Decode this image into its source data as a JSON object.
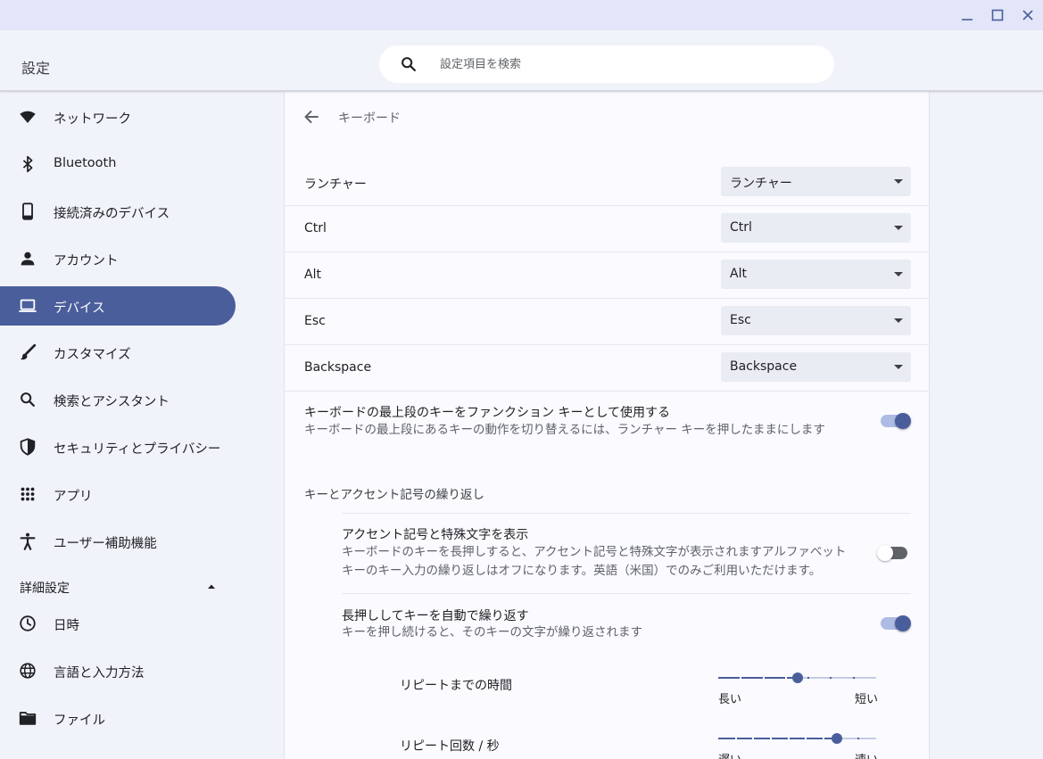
{
  "window": {
    "title": "設定",
    "controls": [
      "minimize-icon",
      "maximize-icon",
      "close-icon"
    ]
  },
  "search": {
    "placeholder": "設定項目を検索"
  },
  "sidebar": {
    "items": [
      {
        "label": "ネットワーク",
        "icon": "wifi-icon"
      },
      {
        "label": "Bluetooth",
        "icon": "bluetooth-icon"
      },
      {
        "label": "接続済みのデバイス",
        "icon": "phone-icon"
      },
      {
        "label": "アカウント",
        "icon": "person-icon"
      },
      {
        "label": "デバイス",
        "icon": "laptop-icon",
        "active": true
      },
      {
        "label": "カスタマイズ",
        "icon": "brush-icon"
      },
      {
        "label": "検索とアシスタント",
        "icon": "search-icon"
      },
      {
        "label": "セキュリティとプライバシー",
        "icon": "shield-icon"
      },
      {
        "label": "アプリ",
        "icon": "apps-grid-icon"
      },
      {
        "label": "ユーザー補助機能",
        "icon": "accessibility-icon"
      }
    ],
    "advanced": {
      "label": "詳細設定",
      "expanded": true
    },
    "advanced_items": [
      {
        "label": "日時",
        "icon": "clock-icon"
      },
      {
        "label": "言語と入力方法",
        "icon": "globe-icon"
      },
      {
        "label": "ファイル",
        "icon": "folder-icon"
      }
    ]
  },
  "page": {
    "title": "キーボード"
  },
  "remap": [
    {
      "label": "ランチャー",
      "value": "ランチャー"
    },
    {
      "label": "Ctrl",
      "value": "Ctrl"
    },
    {
      "label": "Alt",
      "value": "Alt"
    },
    {
      "label": "Esc",
      "value": "Esc"
    },
    {
      "label": "Backspace",
      "value": "Backspace"
    }
  ],
  "function_keys": {
    "title": "キーボードの最上段のキーをファンクション キーとして使用する",
    "desc": "キーボードの最上段にあるキーの動作を切り替えるには、ランチャー キーを押したままにします",
    "enabled": true
  },
  "repeat_section": {
    "label": "キーとアクセント記号の繰り返し"
  },
  "accent": {
    "title": "アクセント記号と特殊文字を表示",
    "desc_line1": "キーボードのキーを長押しすると、アクセント記号と特殊文字が表示されますアルファベット",
    "desc_line2": "キーのキー入力の繰り返しはオフになります。英語（米国）でのみご利用いただけます。",
    "enabled": false
  },
  "autorepeat": {
    "title": "長押ししてキーを自動で繰り返す",
    "desc": "キーを押し続けると、そのキーの文字が繰り返されます",
    "enabled": true
  },
  "delay": {
    "label": "リピートまでの時間",
    "min_label": "長い",
    "max_label": "短い",
    "value": 0.5
  },
  "rate": {
    "label": "リピート回数 / 秒",
    "min_label": "遅い",
    "max_label": "速い",
    "value": 0.75
  },
  "colors": {
    "accent": "#4a5e9c",
    "accent_light": "#aebbe4",
    "background": "#f1f3fa",
    "titlebar": "#e3e6f8"
  }
}
